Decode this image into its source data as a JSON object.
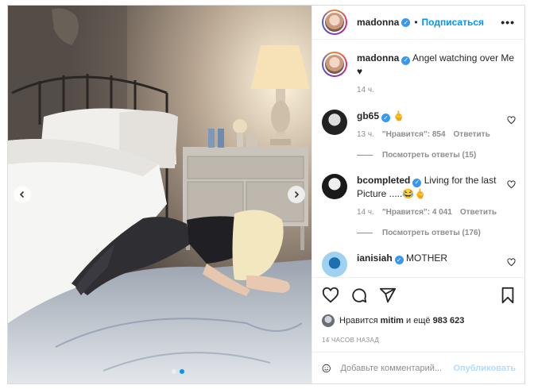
{
  "post": {
    "author": "madonna",
    "follow_label": "Подписаться",
    "dot": "•",
    "more_label": "•••",
    "caption_text": "Angel watching over Me ♥",
    "caption_time": "14 ч."
  },
  "comments": [
    {
      "username": "gb65",
      "text": "🖕",
      "time": "13 ч.",
      "likes": "\"Нравится\": 854",
      "reply": "Ответить",
      "view_replies": "Посмотреть ответы (15)"
    },
    {
      "username": "bcompleted",
      "text": "Living for the last Picture .....😂🖕",
      "time": "14 ч.",
      "likes": "\"Нравится\": 4 041",
      "reply": "Ответить",
      "view_replies": "Посмотреть ответы (176)"
    },
    {
      "username": "ianisiah",
      "text": "MOTHER"
    }
  ],
  "likes": {
    "prefix": "Нравится",
    "user": "mitim",
    "middle": "и ещё",
    "count": "983 623"
  },
  "time_ago": "14 часов назад",
  "composer": {
    "placeholder": "Добавьте комментарий...",
    "publish_label": "Опубликовать"
  },
  "icons": {
    "like": "heart-icon",
    "comment": "comment-icon",
    "share": "share-icon",
    "save": "bookmark-icon",
    "emoji": "emoji-icon",
    "prev": "chevron-left-icon",
    "next": "chevron-right-icon"
  },
  "colors": {
    "accent": "#0095f6",
    "verified": "#3897f0",
    "muted": "#8e8e8e",
    "publish_disabled": "#b3dbff"
  }
}
